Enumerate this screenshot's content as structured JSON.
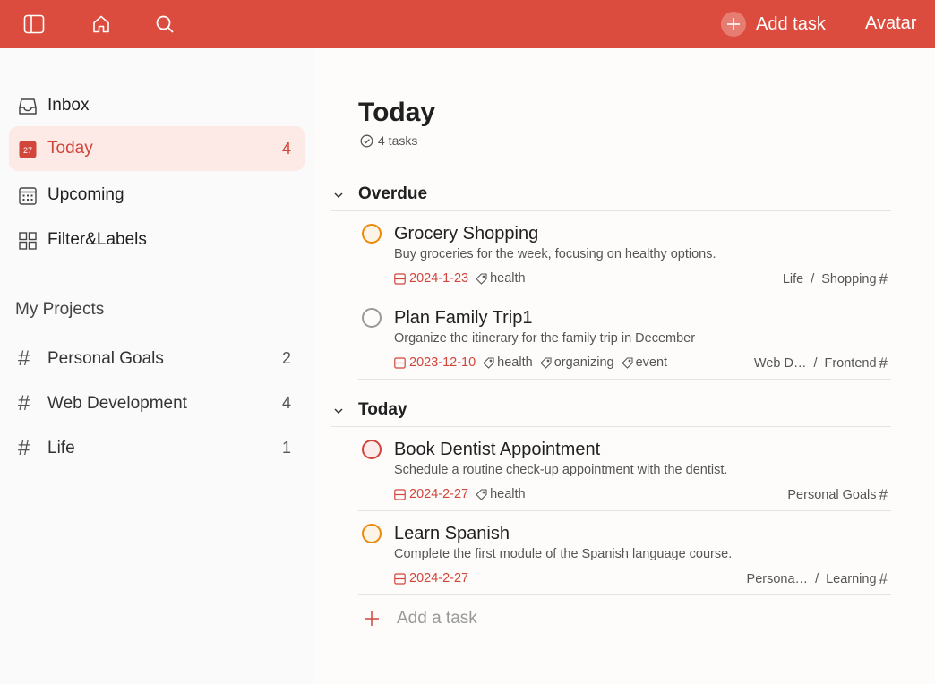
{
  "colors": {
    "brand": "#dc4c3e",
    "accent_text": "#d1453b",
    "active_bg": "#fde9e5",
    "priority_orange": "#eb8909",
    "priority_red": "#d1453b"
  },
  "topbar": {
    "icons": [
      "sidebar-toggle-icon",
      "home-icon",
      "search-icon"
    ],
    "add_task_label": "Add task",
    "avatar_label": "Avatar"
  },
  "sidebar": {
    "nav": [
      {
        "label": "Inbox",
        "count": "",
        "icon": "inbox-icon"
      },
      {
        "label": "Today",
        "count": "4",
        "icon": "calendar-today-icon",
        "badge": "27"
      },
      {
        "label": "Upcoming",
        "count": "",
        "icon": "calendar-grid-icon"
      },
      {
        "label": "Filter&Labels",
        "count": "",
        "icon": "grid-icon"
      }
    ],
    "projects_title": "My Projects",
    "projects": [
      {
        "label": "Personal Goals",
        "count": "2"
      },
      {
        "label": "Web Development",
        "count": "4"
      },
      {
        "label": "Life",
        "count": "1"
      }
    ]
  },
  "main": {
    "title": "Today",
    "task_count": "4 tasks",
    "groups": [
      {
        "label": "Overdue",
        "tasks": [
          {
            "title": "Grocery Shopping",
            "description": "Buy groceries for the week, focusing on healthy options.",
            "date": "2024-1-23",
            "labels": [
              "health"
            ],
            "project": "Life",
            "section": "Shopping",
            "priority": "p2"
          },
          {
            "title": "Plan Family Trip1",
            "description": "Organize the itinerary for the family trip in December",
            "date": "2023-12-10",
            "labels": [
              "health",
              "organizing",
              "event"
            ],
            "project": "Web D…",
            "section": "Frontend",
            "priority": "p4"
          }
        ]
      },
      {
        "label": "Today",
        "tasks": [
          {
            "title": "Book Dentist Appointment",
            "description": "Schedule a routine check-up appointment with the dentist.",
            "date": "2024-2-27",
            "labels": [
              "health"
            ],
            "project": "Personal Goals",
            "section": "",
            "priority": "p1"
          },
          {
            "title": "Learn Spanish",
            "description": "Complete the first module of the Spanish language course.",
            "date": "2024-2-27",
            "labels": [],
            "project": "Persona…",
            "section": "Learning",
            "priority": "p2"
          }
        ]
      }
    ],
    "add_task_label": "Add a task"
  }
}
